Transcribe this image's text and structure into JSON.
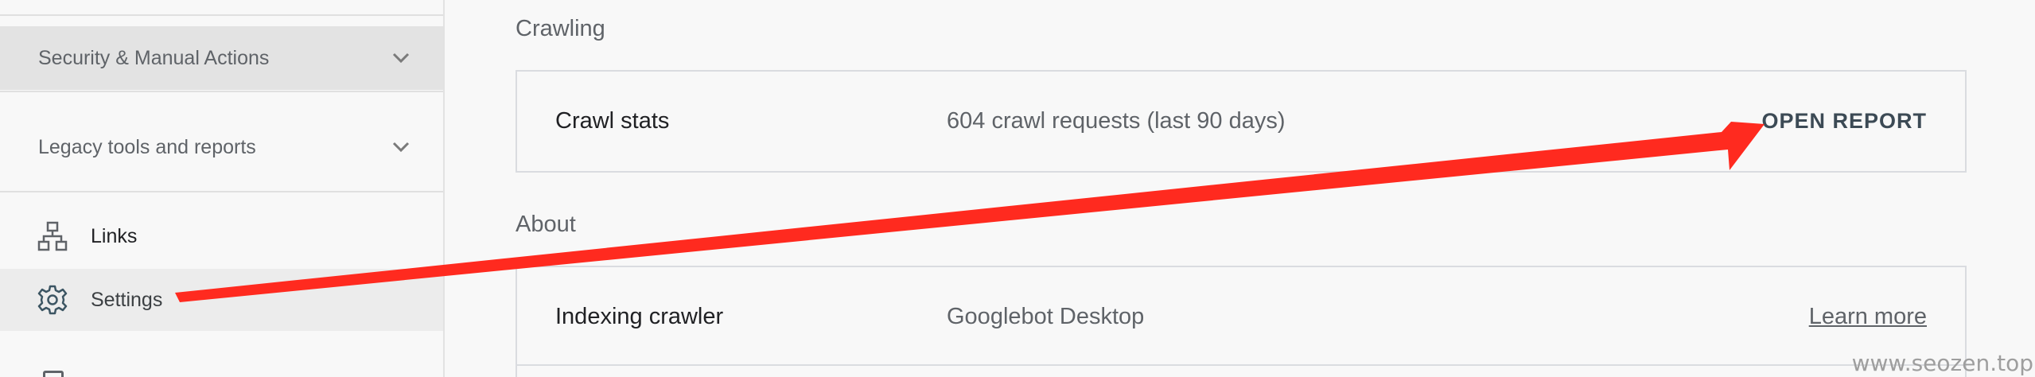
{
  "sidebar": {
    "sections": [
      {
        "label": "Security & Manual Actions",
        "icon": "chevron-down-icon",
        "active": true
      },
      {
        "label": "Legacy tools and reports",
        "icon": "chevron-down-icon",
        "active": false
      }
    ],
    "items": [
      {
        "label": "Links",
        "icon": "links-icon",
        "active": false
      },
      {
        "label": "Settings",
        "icon": "gear-icon",
        "active": true
      }
    ]
  },
  "main": {
    "crawling": {
      "title": "Crawling",
      "rows": [
        {
          "name": "Crawl stats",
          "value": "604 crawl requests (last 90 days)",
          "action": "OPEN REPORT"
        }
      ]
    },
    "about": {
      "title": "About",
      "rows": [
        {
          "name": "Indexing crawler",
          "value": "Googlebot Desktop",
          "link": "Learn more"
        }
      ]
    }
  },
  "annotation": {
    "color": "#ff2a1f"
  },
  "watermark": "www.seozen.top",
  "colors": {
    "background": "#f8f8f8",
    "active_section": "#e3e3e3",
    "border": "#dadce0",
    "text_primary": "#202124",
    "text_secondary": "#5f6368",
    "action_text": "#3c4a55"
  }
}
